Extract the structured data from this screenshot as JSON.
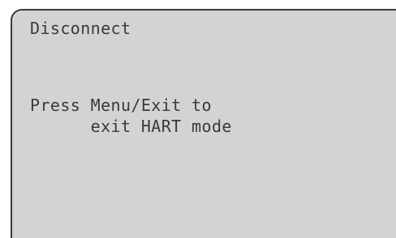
{
  "screen": {
    "title": "Disconnect",
    "message_line1": "Press Menu/Exit to",
    "message_line2": "      exit HART mode"
  },
  "colors": {
    "lcd_background": "#d3d3d3",
    "text": "#3a3a3a",
    "border": "#3a3a3a"
  }
}
